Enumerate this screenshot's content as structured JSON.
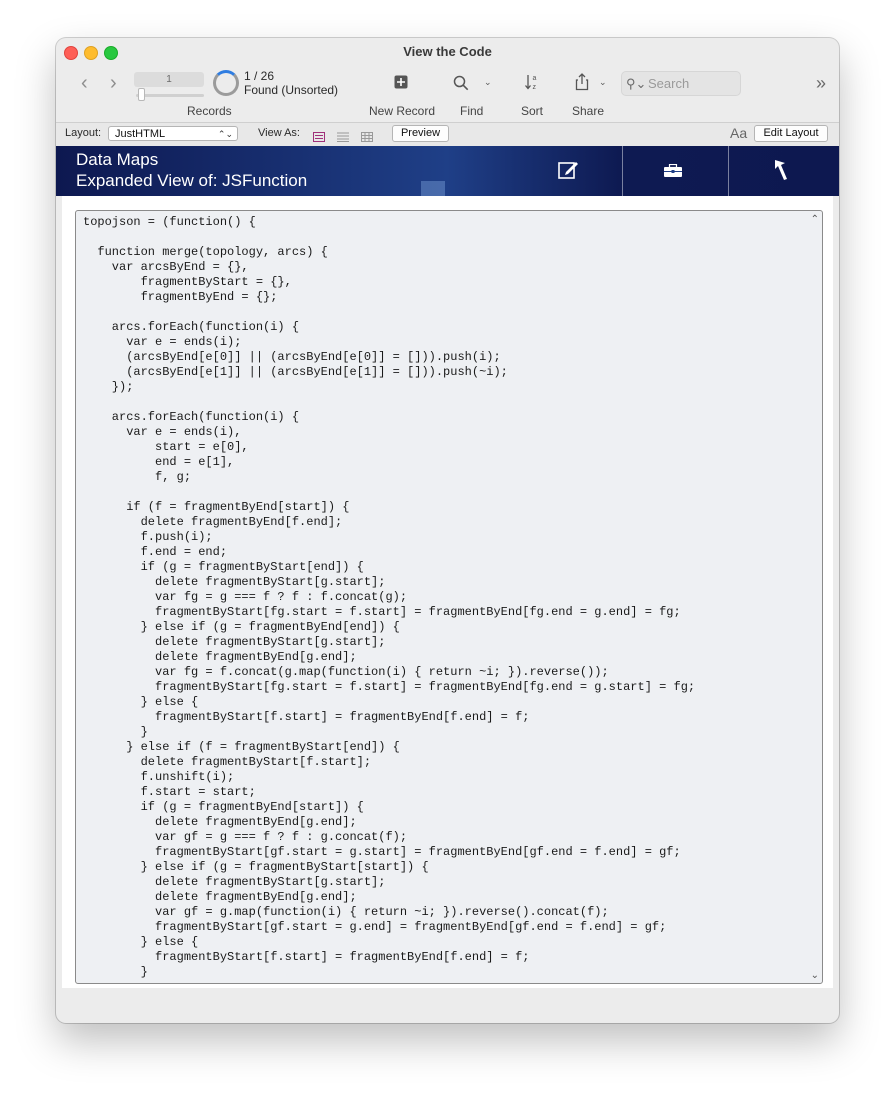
{
  "window": {
    "title": "View the Code"
  },
  "toolbar": {
    "record_field_value": "1",
    "record_count": "1 / 26",
    "found_status": "Found (Unsorted)",
    "records_label": "Records",
    "new_record_label": "New Record",
    "find_label": "Find",
    "sort_label": "Sort",
    "share_label": "Share",
    "search_placeholder": "Search"
  },
  "layout_bar": {
    "layout_label": "Layout:",
    "layout_value": "JustHTML",
    "view_as_label": "View As:",
    "preview_label": "Preview",
    "edit_layout_label": "Edit Layout",
    "text_size_glyph": "Aa"
  },
  "header": {
    "title": "Data Maps",
    "subtitle": "Expanded View of: JSFunction",
    "accent": "#0d1850"
  },
  "code": {
    "lines": [
      "topojson = (function() {",
      "",
      "  function merge(topology, arcs) {",
      "    var arcsByEnd = {},",
      "        fragmentByStart = {},",
      "        fragmentByEnd = {};",
      "",
      "    arcs.forEach(function(i) {",
      "      var e = ends(i);",
      "      (arcsByEnd[e[0]] || (arcsByEnd[e[0]] = [])).push(i);",
      "      (arcsByEnd[e[1]] || (arcsByEnd[e[1]] = [])).push(~i);",
      "    });",
      "",
      "    arcs.forEach(function(i) {",
      "      var e = ends(i),",
      "          start = e[0],",
      "          end = e[1],",
      "          f, g;",
      "",
      "      if (f = fragmentByEnd[start]) {",
      "        delete fragmentByEnd[f.end];",
      "        f.push(i);",
      "        f.end = end;",
      "        if (g = fragmentByStart[end]) {",
      "          delete fragmentByStart[g.start];",
      "          var fg = g === f ? f : f.concat(g);",
      "          fragmentByStart[fg.start = f.start] = fragmentByEnd[fg.end = g.end] = fg;",
      "        } else if (g = fragmentByEnd[end]) {",
      "          delete fragmentByStart[g.start];",
      "          delete fragmentByEnd[g.end];",
      "          var fg = f.concat(g.map(function(i) { return ~i; }).reverse());",
      "          fragmentByStart[fg.start = f.start] = fragmentByEnd[fg.end = g.start] = fg;",
      "        } else {",
      "          fragmentByStart[f.start] = fragmentByEnd[f.end] = f;",
      "        }",
      "      } else if (f = fragmentByStart[end]) {",
      "        delete fragmentByStart[f.start];",
      "        f.unshift(i);",
      "        f.start = start;",
      "        if (g = fragmentByEnd[start]) {",
      "          delete fragmentByEnd[g.end];",
      "          var gf = g === f ? f : g.concat(f);",
      "          fragmentByStart[gf.start = g.start] = fragmentByEnd[gf.end = f.end] = gf;",
      "        } else if (g = fragmentByStart[start]) {",
      "          delete fragmentByStart[g.start];",
      "          delete fragmentByEnd[g.end];",
      "          var gf = g.map(function(i) { return ~i; }).reverse().concat(f);",
      "          fragmentByStart[gf.start = g.end] = fragmentByEnd[gf.end = f.end] = gf;",
      "        } else {",
      "          fragmentByStart[f.start] = fragmentByEnd[f.end] = f;",
      "        }"
    ]
  },
  "icons": {
    "back": "chevron-left-icon",
    "forward": "chevron-right-icon",
    "new_record": "plus-square-icon",
    "find": "magnifier-icon",
    "sort": "sort-az-icon",
    "share": "share-icon",
    "edit": "pencil-square-icon",
    "toolbox": "toolbox-icon",
    "back_arrow": "return-arrow-icon"
  }
}
